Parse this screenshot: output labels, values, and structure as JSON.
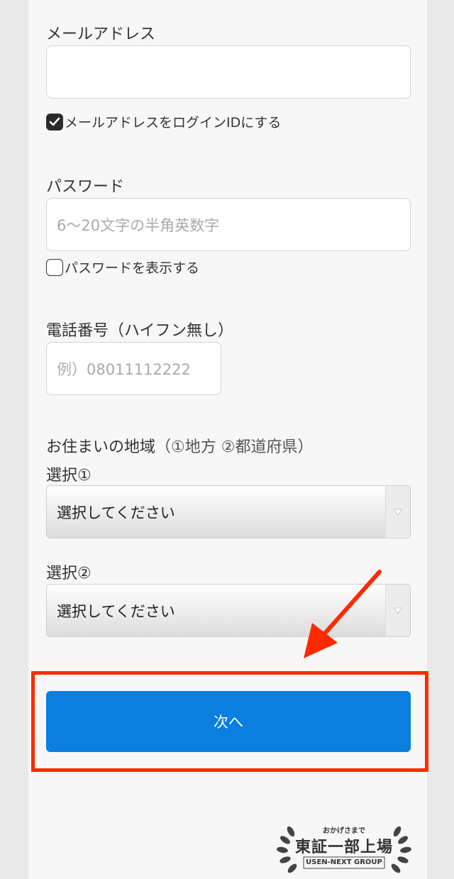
{
  "email": {
    "label": "メールアドレス",
    "value": "",
    "use_as_login_label": "メールアドレスをログインIDにする",
    "use_as_login_checked": true
  },
  "password": {
    "label": "パスワード",
    "placeholder": "6〜20文字の半角英数字",
    "show_label": "パスワードを表示する",
    "show_checked": false
  },
  "phone": {
    "label": "電話番号（ハイフン無し）",
    "placeholder": "例）08011112222"
  },
  "region": {
    "label": "お住まいの地域",
    "label_sub": "（①地方 ②都道府県）",
    "select1_label": "選択①",
    "select1_value": "選択してください",
    "select2_label": "選択②",
    "select2_value": "選択してください"
  },
  "next_button": {
    "label": "次へ"
  },
  "colors": {
    "button": "#0a7fe0",
    "highlight": "#ff2a00",
    "arrow": "#ff2a00"
  },
  "badge": {
    "top": "おかげさまで",
    "main": "東証一部上場",
    "bottom": "USEN-NEXT GROUP"
  }
}
